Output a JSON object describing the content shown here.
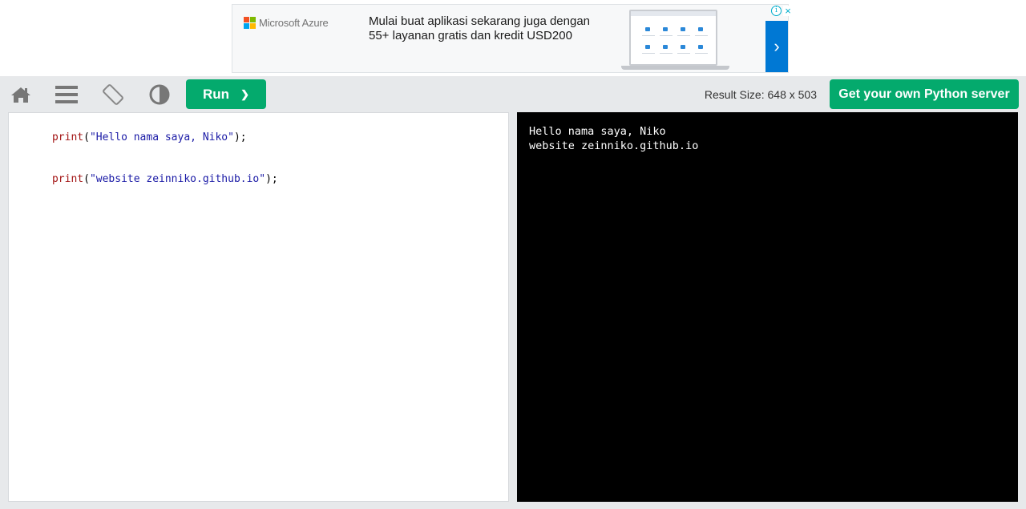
{
  "ad": {
    "brand": "Microsoft Azure",
    "headline": "Mulai buat aplikasi sekarang juga dengan 55+ layanan gratis dan kredit USD200",
    "next_glyph": "›",
    "info_glyph": "i",
    "close_glyph": "×",
    "brand_colors": [
      "#f25022",
      "#7fba00",
      "#00a4ef",
      "#ffb900"
    ],
    "accent": "#0078d4"
  },
  "toolbar": {
    "icons": [
      "home-icon",
      "menu-icon",
      "rotate-icon",
      "contrast-icon"
    ],
    "run_label": "Run",
    "run_glyph": "❯",
    "result_size": "Result Size: 648 x 503",
    "get_server_label": "Get your own Python server",
    "accent": "#04aa6d"
  },
  "editor": {
    "lines": [
      {
        "fn": "print",
        "open": "(",
        "str": "\"Hello nama saya, Niko\"",
        "close": ");"
      },
      {
        "fn": "print",
        "open": "(",
        "str": "\"website zeinniko.github.io\"",
        "close": ");"
      }
    ]
  },
  "output": {
    "lines": [
      "Hello nama saya, Niko",
      "website zeinniko.github.io"
    ]
  }
}
